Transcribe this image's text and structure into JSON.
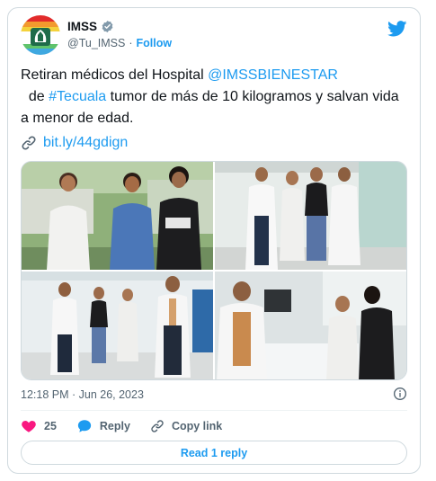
{
  "account": {
    "display_name": "IMSS",
    "handle": "@Tu_IMSS",
    "separator": "·",
    "follow_label": "Follow"
  },
  "tweet": {
    "text_1": "Retiran médicos del Hospital ",
    "mention": "@IMSSBIENESTAR",
    "text_2": "  de ",
    "hashtag": "#Tecuala",
    "text_3": " tumor de más de 10 kilogramos y salvan vida a menor de edad.",
    "link": "bit.ly/44gdign"
  },
  "photos": [
    {
      "alt_name": "photo-1"
    },
    {
      "alt_name": "photo-2"
    },
    {
      "alt_name": "photo-3"
    },
    {
      "alt_name": "photo-4"
    }
  ],
  "meta": {
    "timestamp": "12:18 PM · Jun 26, 2023"
  },
  "actions": {
    "like_count": "25",
    "reply_label": "Reply",
    "copy_link_label": "Copy link",
    "read_reply_label": "Read 1 reply"
  },
  "colors": {
    "accent": "#1d9bf0",
    "like": "#f91880",
    "text": "#0f1419",
    "muted": "#536471",
    "border": "#cfd9de"
  },
  "icons": [
    "imss-logo-icon",
    "verified-badge-icon",
    "twitter-bird-icon",
    "link-icon",
    "info-icon",
    "heart-icon",
    "reply-bubble-icon",
    "copy-link-icon"
  ]
}
